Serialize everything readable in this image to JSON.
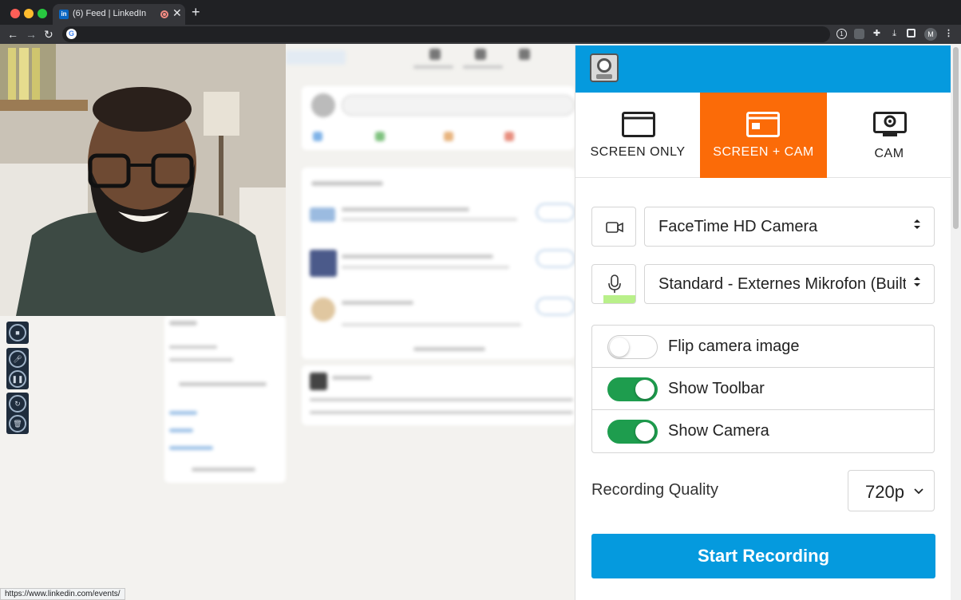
{
  "browser": {
    "tab_title": "(6) Feed | LinkedIn",
    "tab_favicon": "in",
    "new_tab": "+",
    "close": "✕",
    "profile_initial": "M",
    "status_url": "https://www.linkedin.com/events/"
  },
  "colors": {
    "header_blue": "#059ade",
    "active_mode_orange": "#fb6b08",
    "toggle_on_green": "#1e9d4e"
  },
  "recorder": {
    "modes": [
      {
        "label": "SCREEN ONLY",
        "icon": "browser-window-icon",
        "active": false
      },
      {
        "label": "SCREEN + CAM",
        "icon": "browser-window-cam-icon",
        "active": true
      },
      {
        "label": "CAM",
        "icon": "webcam-monitor-icon",
        "active": false
      }
    ],
    "camera_select": "FaceTime HD Camera",
    "microphone_select": "Standard - Externes Mikrofon (Built-in)",
    "toggles": [
      {
        "label": "Flip camera image",
        "on": false
      },
      {
        "label": "Show Toolbar",
        "on": true
      },
      {
        "label": "Show Camera",
        "on": true
      }
    ],
    "quality_label": "Recording Quality",
    "quality_value": "720p",
    "start_button": "Start Recording"
  }
}
